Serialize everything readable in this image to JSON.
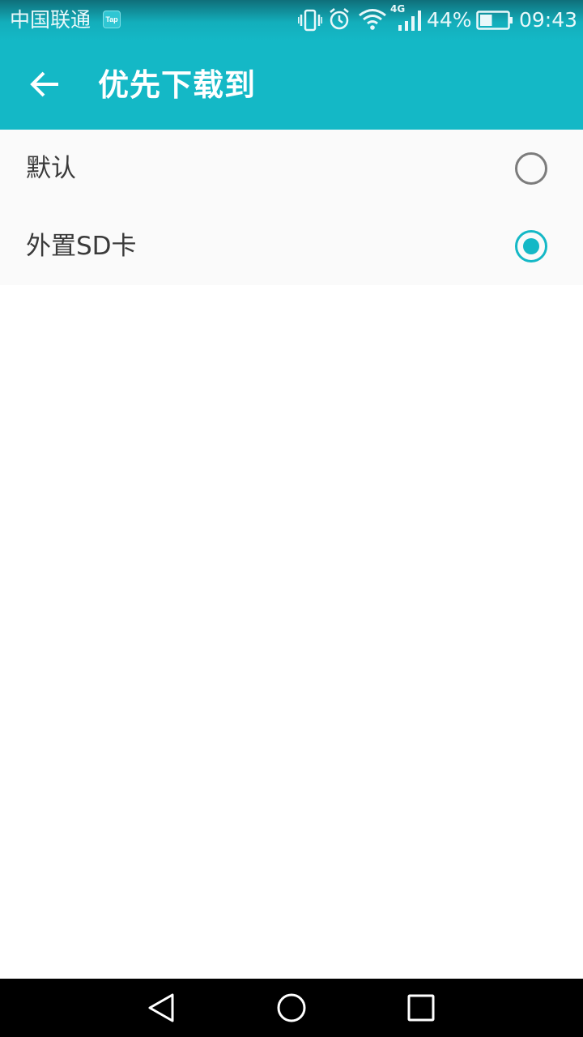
{
  "status_bar": {
    "carrier": "中国联通",
    "notification_badge": "Tap",
    "network_type": "4G",
    "battery_percent": "44%",
    "battery_level": 0.44,
    "time": "09:43",
    "icons": [
      "vibrate-icon",
      "alarm-icon",
      "wifi-icon",
      "signal-icon",
      "battery-icon"
    ]
  },
  "app_bar": {
    "title": "优先下载到",
    "back_icon": "arrow-left-icon"
  },
  "options": [
    {
      "label": "默认",
      "selected": false
    },
    {
      "label": "外置SD卡",
      "selected": true
    }
  ],
  "navigation": {
    "icons": [
      "back-triangle-icon",
      "home-circle-icon",
      "recents-square-icon"
    ]
  },
  "colors": {
    "accent": "#14b8c6",
    "radio_unselected": "#7c7c7c",
    "list_background": "#fafafa",
    "nav_bar": "#000000"
  }
}
